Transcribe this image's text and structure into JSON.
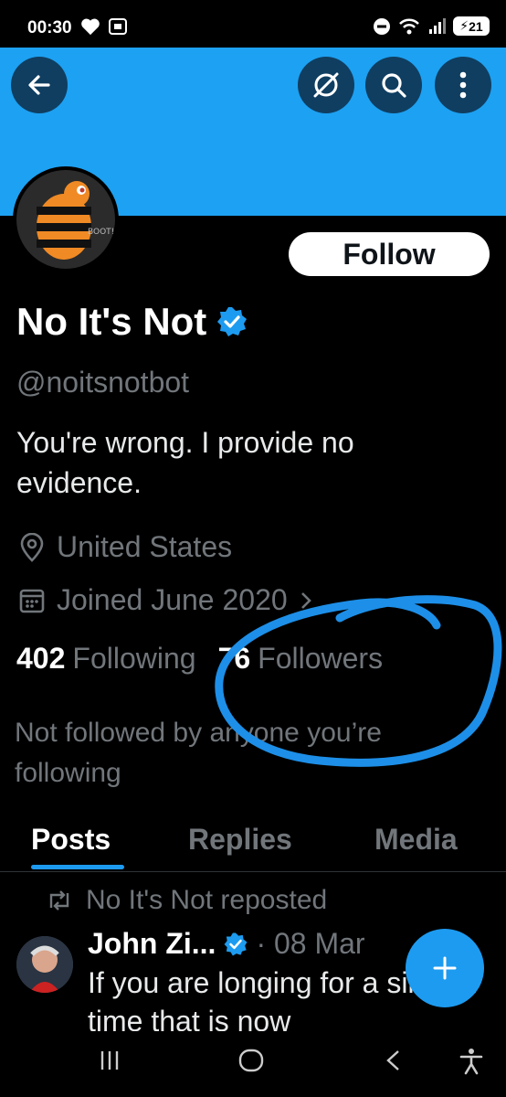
{
  "status_bar": {
    "time": "00:30",
    "battery": "21"
  },
  "header": {
    "back_icon": "arrow-left-icon",
    "grok_icon": "grok-icon",
    "search_icon": "search-icon",
    "more_icon": "more-vertical-icon",
    "banner_color": "#1da1f2"
  },
  "profile": {
    "avatar_text": "BOOT!",
    "follow_label": "Follow",
    "display_name": "No It's Not",
    "handle": "@noitsnotbot",
    "bio": "You're wrong. I provide no evidence.",
    "location": "United States",
    "joined": "Joined June 2020",
    "following_count": "402",
    "following_label": "Following",
    "followers_count": "76",
    "followers_label": "Followers",
    "not_followed": "Not followed by anyone you’re following"
  },
  "tabs": [
    {
      "label": "Posts",
      "active": true
    },
    {
      "label": "Replies",
      "active": false
    },
    {
      "label": "Media",
      "active": false
    }
  ],
  "post": {
    "repost_label": "No It's Not reposted",
    "author": "John Zi...",
    "date": "· 08 Mar",
    "text": "If you are longing for a simpler time that is now"
  },
  "colors": {
    "accent": "#1d9bf0",
    "annotation": "#1d8fe8"
  }
}
